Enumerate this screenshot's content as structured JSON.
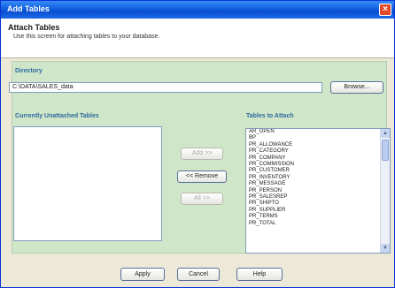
{
  "window": {
    "title": "Add Tables",
    "close_label": "×"
  },
  "header": {
    "title": "Attach Tables",
    "subtitle": "Use this screen for attaching tables to your database."
  },
  "directory": {
    "label": "Directory",
    "value": "C:\\DATA\\SALES_data",
    "browse_label": "Browse..."
  },
  "unattached": {
    "label": "Currently Unattached Tables",
    "items": []
  },
  "actions": {
    "add_label": "Add >>",
    "remove_label": "<< Remove",
    "all_label": "All >>"
  },
  "attach": {
    "label": "Tables to Attach",
    "items": [
      "AR_OPEN",
      "BP",
      "PR_ALLOWANCE",
      "PR_CATEGORY",
      "PR_COMPANY",
      "PR_COMMISSION",
      "PR_CUSTOMER",
      "PR_INVENTORY",
      "PR_MESSAGE",
      "PR_PERSON",
      "PR_SALESREP",
      "PR_SHIPTO",
      "PR_SUPPLIER",
      "PR_TERMS",
      "PR_TOTAL"
    ]
  },
  "footer": {
    "apply_label": "Apply",
    "cancel_label": "Cancel",
    "help_label": "Help"
  }
}
